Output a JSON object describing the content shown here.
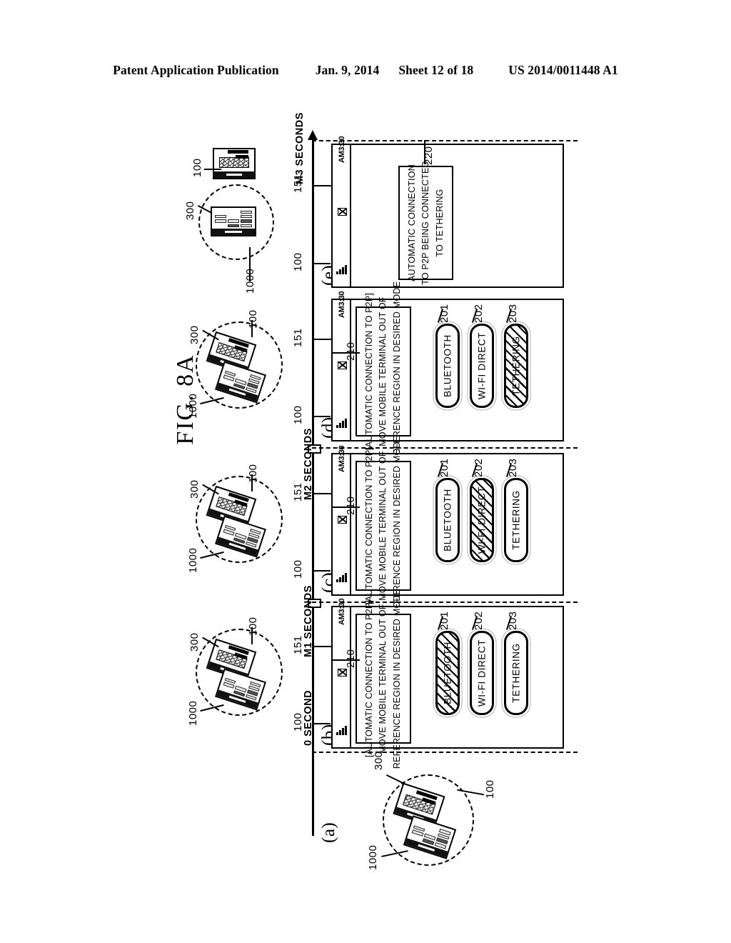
{
  "header": {
    "publication": "Patent Application Publication",
    "date": "Jan. 9, 2014",
    "sheet": "Sheet 12 of 18",
    "patent_number": "US 2014/0011448 A1"
  },
  "figure": {
    "title": "FIG. 8A"
  },
  "timeline": {
    "marks": [
      {
        "id": "t0",
        "label": "0 SECOND"
      },
      {
        "id": "t1",
        "label": "M1 SECONDS"
      },
      {
        "id": "t2",
        "label": "M2 SECONDS"
      },
      {
        "id": "t3",
        "label": "M3 SECONDS"
      }
    ]
  },
  "panels": [
    {
      "key": "a",
      "label": "(a)",
      "illustration": {
        "region_ref": "300",
        "device_ref": "100",
        "peer_ref": "1000",
        "device_inside_region": true
      },
      "screen": null
    },
    {
      "key": "b",
      "label": "(b)",
      "refs": {
        "device": "100",
        "statusbar": "151",
        "dialog": "210"
      },
      "illustration": {
        "region_ref": "300",
        "device_ref": "100",
        "peer_ref": "1000",
        "device_inside_region": true
      },
      "screen": {
        "statusbar": {
          "time": "AM3:30",
          "icons": [
            "signal-icon",
            "message-icon"
          ]
        },
        "dialog": {
          "ref": "210",
          "lines": [
            "[AUTOMATIC CONNECTION TO P2P]",
            "MOVE MOBILE TERMINAL OUT OF",
            "REFERENCE REGION IN DESIRED MODE"
          ]
        },
        "options": [
          {
            "ref": "201",
            "label": "BLUETOOTH",
            "selected": true
          },
          {
            "ref": "202",
            "label": "WI-FI DIRECT",
            "selected": false
          },
          {
            "ref": "203",
            "label": "TETHERING",
            "selected": false
          }
        ]
      }
    },
    {
      "key": "c",
      "label": "(c)",
      "refs": {
        "device": "100",
        "statusbar": "151",
        "dialog": "210"
      },
      "illustration": {
        "region_ref": "300",
        "device_ref": "100",
        "peer_ref": "1000",
        "device_inside_region": true
      },
      "screen": {
        "statusbar": {
          "time": "AM3:30",
          "icons": [
            "signal-icon",
            "message-icon"
          ]
        },
        "dialog": {
          "ref": "210",
          "lines": [
            "[AUTOMATIC CONNECTION TO P2P]",
            "MOVE MOBILE TERMINAL OUT OF",
            "REFERENCE REGION IN DESIRED MODE"
          ]
        },
        "options": [
          {
            "ref": "201",
            "label": "BLUETOOTH",
            "selected": false
          },
          {
            "ref": "202",
            "label": "WI-FI DIRECT",
            "selected": true
          },
          {
            "ref": "203",
            "label": "TETHERING",
            "selected": false
          }
        ]
      }
    },
    {
      "key": "d",
      "label": "(d)",
      "refs": {
        "device": "100",
        "statusbar": "151",
        "dialog": "210"
      },
      "illustration": {
        "region_ref": "300",
        "device_ref": "100",
        "peer_ref": "1000",
        "device_inside_region": true
      },
      "screen": {
        "statusbar": {
          "time": "AM3:30",
          "icons": [
            "signal-icon",
            "message-icon"
          ]
        },
        "dialog": {
          "ref": "210",
          "lines": [
            "[AUTOMATIC CONNECTION TO P2P]",
            "MOVE MOBILE TERMINAL OUT OF",
            "REFERENCE REGION IN DESIRED MODE"
          ]
        },
        "options": [
          {
            "ref": "201",
            "label": "BLUETOOTH",
            "selected": false
          },
          {
            "ref": "202",
            "label": "WI-FI DIRECT",
            "selected": false
          },
          {
            "ref": "203",
            "label": "TETHERING",
            "selected": true
          }
        ]
      }
    },
    {
      "key": "e",
      "label": "(e)",
      "refs": {
        "device": "100",
        "statusbar": "151",
        "notice": "220"
      },
      "illustration": {
        "region_ref": "300",
        "device_ref": "100",
        "peer_ref": "1000",
        "device_inside_region": false
      },
      "screen": {
        "statusbar": {
          "time": "AM3:30",
          "icons": [
            "signal-icon",
            "message-icon"
          ]
        },
        "notice": {
          "ref": "220",
          "lines": [
            "AUTOMATIC CONNECTION",
            "TO P2P BEING CONNECTED",
            "TO TETHERING"
          ]
        }
      }
    }
  ],
  "reference_numerals": {
    "mobile_terminal": "100",
    "status_bar": "151",
    "option_bluetooth": "201",
    "option_wifi_direct": "202",
    "option_tethering": "203",
    "dialog_popup": "210",
    "connection_notice": "220",
    "reference_region": "300",
    "peer_terminal": "1000"
  }
}
